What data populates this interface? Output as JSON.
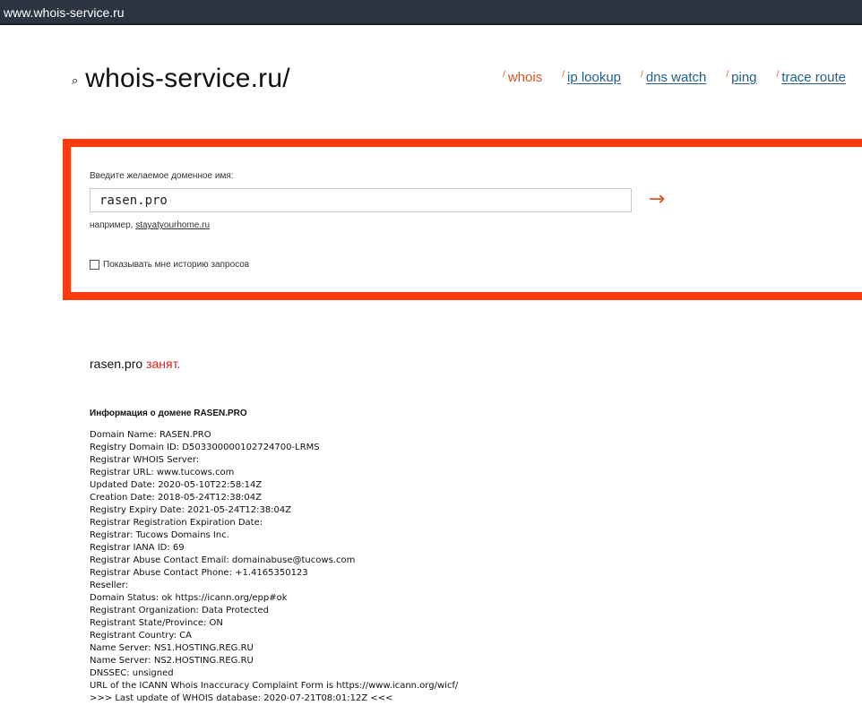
{
  "browser": {
    "url": "www.whois-service.ru"
  },
  "header": {
    "logo_icon": "magnifier-icon",
    "logo_text": "whois-service.ru/",
    "nav": [
      {
        "label": "whois",
        "active": true
      },
      {
        "label": "ip lookup",
        "active": false
      },
      {
        "label": "dns watch",
        "active": false
      },
      {
        "label": "ping",
        "active": false
      },
      {
        "label": "trace route",
        "active": false
      }
    ],
    "nav_slash": "/"
  },
  "search": {
    "label": "Введите желаемое доменное имя:",
    "value": "rasen.pro",
    "submit_glyph": "→",
    "example_prefix": "например,",
    "example_domain": "stayatyourhome.ru",
    "history_label": "Показывать мне историю запросов",
    "history_checked": false
  },
  "result": {
    "domain": "rasen.pro",
    "status": "занят.",
    "info_heading": "Информация о домене RASEN.PRO",
    "lines": [
      "Domain Name: RASEN.PRO",
      "Registry Domain ID: D503300000102724700-LRMS",
      "Registrar WHOIS Server:",
      "Registrar URL: www.tucows.com",
      "Updated Date: 2020-05-10T22:58:14Z",
      "Creation Date: 2018-05-24T12:38:04Z",
      "Registry Expiry Date: 2021-05-24T12:38:04Z",
      "Registrar Registration Expiration Date:",
      "Registrar: Tucows Domains Inc.",
      "Registrar IANA ID: 69",
      "Registrar Abuse Contact Email: domainabuse@tucows.com",
      "Registrar Abuse Contact Phone: +1.4165350123",
      "Reseller:",
      "Domain Status: ok https://icann.org/epp#ok",
      "Registrant Organization: Data Protected",
      "Registrant State/Province: ON",
      "Registrant Country: CA",
      "Name Server: NS1.HOSTING.REG.RU",
      "Name Server: NS2.HOSTING.REG.RU",
      "DNSSEC: unsigned",
      "URL of the ICANN Whois Inaccuracy Complaint Form is https://www.icann.org/wicf/",
      ">>> Last update of WHOIS database: 2020-07-21T08:01:12Z <<<"
    ]
  },
  "colors": {
    "accent": "#ff3b0e",
    "link": "#1f5f8a",
    "taken": "#e0201a"
  }
}
